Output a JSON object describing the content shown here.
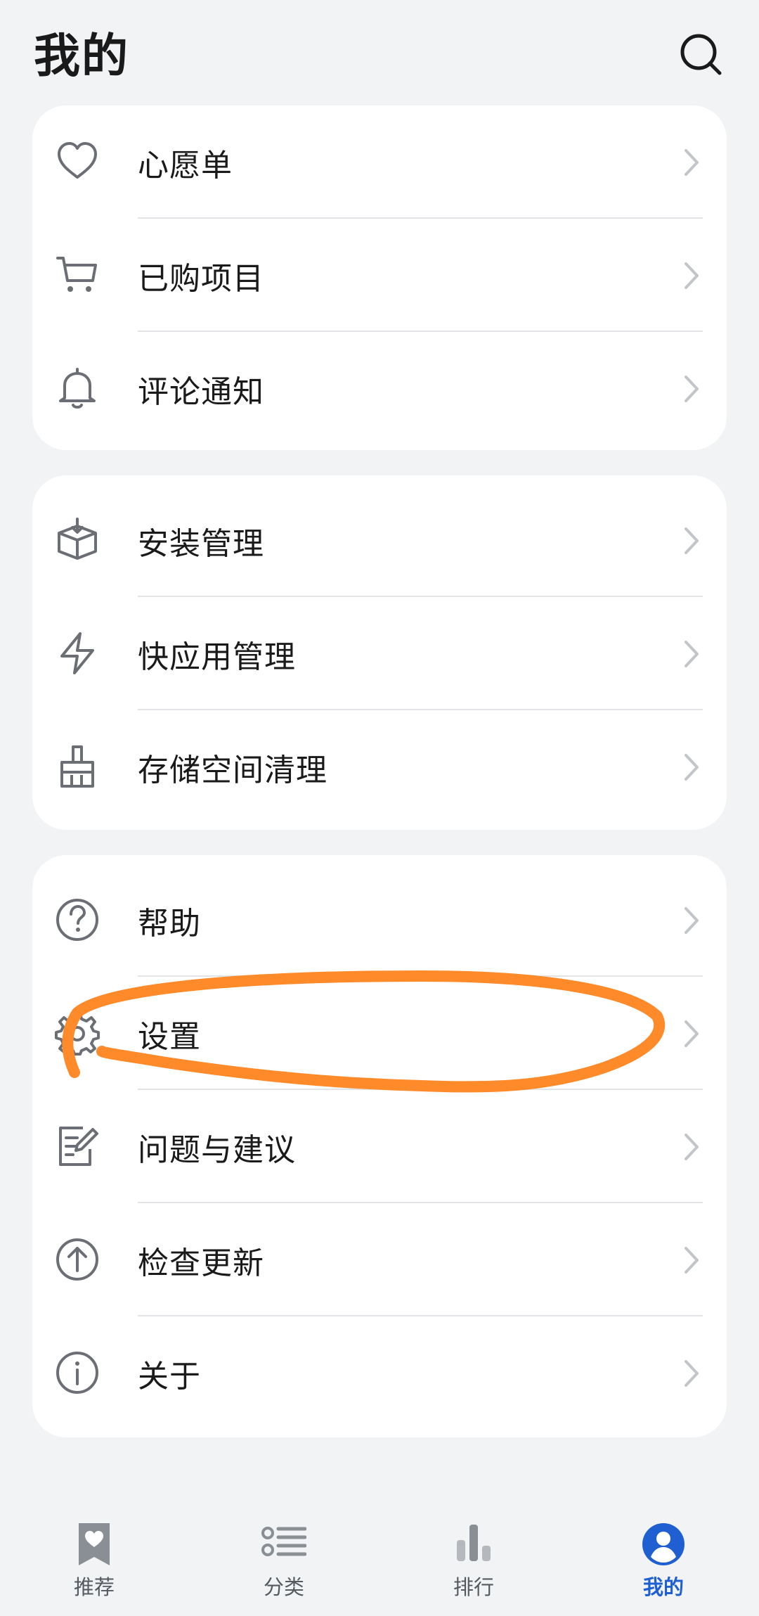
{
  "header": {
    "title": "我的",
    "search_icon": "search-icon"
  },
  "sections": [
    {
      "items": [
        {
          "label": "心愿单",
          "icon": "heart-icon"
        },
        {
          "label": "已购项目",
          "icon": "cart-icon"
        },
        {
          "label": "评论通知",
          "icon": "bell-icon"
        }
      ]
    },
    {
      "items": [
        {
          "label": "安装管理",
          "icon": "box-download-icon"
        },
        {
          "label": "快应用管理",
          "icon": "lightning-icon"
        },
        {
          "label": "存储空间清理",
          "icon": "broom-icon"
        }
      ]
    },
    {
      "items": [
        {
          "label": "帮助",
          "icon": "help-icon"
        },
        {
          "label": "设置",
          "icon": "gear-icon"
        },
        {
          "label": "问题与建议",
          "icon": "feedback-icon"
        },
        {
          "label": "检查更新",
          "icon": "upload-arrow-icon"
        },
        {
          "label": "关于",
          "icon": "info-icon"
        }
      ]
    }
  ],
  "bottom_nav": {
    "items": [
      {
        "label": "推荐",
        "icon": "bookmark-heart-icon",
        "active": false
      },
      {
        "label": "分类",
        "icon": "list-icon",
        "active": false
      },
      {
        "label": "排行",
        "icon": "bar-chart-icon",
        "active": false
      },
      {
        "label": "我的",
        "icon": "profile-icon",
        "active": true
      }
    ]
  },
  "colors": {
    "background": "#f1f3f5",
    "card": "#ffffff",
    "accent": "#1f5fd1",
    "annotation": "#ff8a2a",
    "icon": "#6b6f75"
  }
}
